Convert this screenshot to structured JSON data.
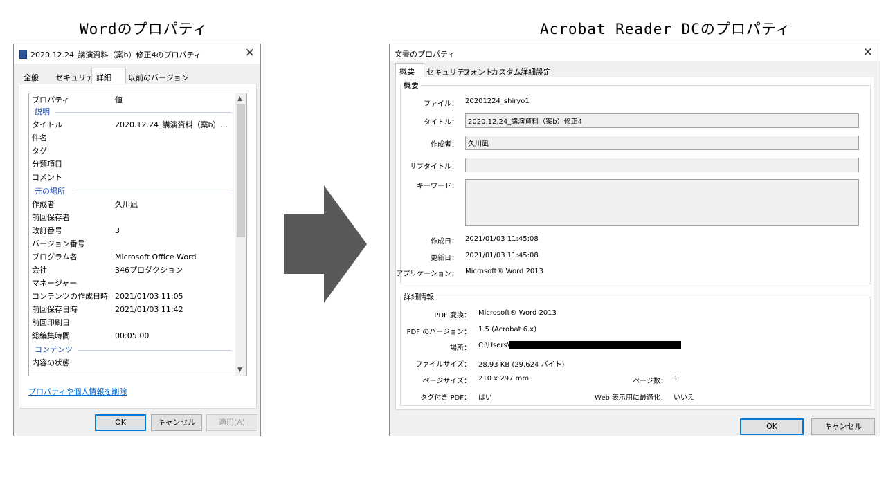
{
  "headings": {
    "left": "Wordのプロパティ",
    "right": "Acrobat Reader DCのプロパティ"
  },
  "colors": {
    "accent": "#0078d7",
    "arrow": "#595959",
    "group_header": "#1e4fb3",
    "link": "#0066cc"
  },
  "word": {
    "window_title": "2020.12.24_講演資料（案b）修正4のプロパティ",
    "icon": "word-doc-icon",
    "close": "✕",
    "tabs": [
      "全般",
      "セキュリティ",
      "詳細",
      "以前のバージョン"
    ],
    "active_tab": "詳細",
    "columns": {
      "property": "プロパティ",
      "value": "値"
    },
    "groups": {
      "description": "説明",
      "origin": "元の場所",
      "content": "コンテンツ"
    },
    "rows": [
      {
        "name": "タイトル",
        "value": "2020.12.24_講演資料（案b）..."
      },
      {
        "name": "件名",
        "value": ""
      },
      {
        "name": "タグ",
        "value": ""
      },
      {
        "name": "分類項目",
        "value": ""
      },
      {
        "name": "コメント",
        "value": ""
      },
      {
        "name": "作成者",
        "value": "久川凪"
      },
      {
        "name": "前回保存者",
        "value": ""
      },
      {
        "name": "改訂番号",
        "value": "3"
      },
      {
        "name": "バージョン番号",
        "value": ""
      },
      {
        "name": "プログラム名",
        "value": "Microsoft Office Word"
      },
      {
        "name": "会社",
        "value": "346プロダクション"
      },
      {
        "name": "マネージャー",
        "value": ""
      },
      {
        "name": "コンテンツの作成日時",
        "value": "2021/01/03 11:05"
      },
      {
        "name": "前回保存日時",
        "value": "2021/01/03 11:42"
      },
      {
        "name": "前回印刷日",
        "value": ""
      },
      {
        "name": "総編集時間",
        "value": "00:05:00"
      },
      {
        "name": "内容の状態",
        "value": ""
      }
    ],
    "remove_link": "プロパティや個人情報を削除",
    "buttons": {
      "ok": "OK",
      "cancel": "キャンセル",
      "apply": "適用(A)"
    }
  },
  "acrobat": {
    "window_title": "文書のプロパティ",
    "close": "✕",
    "tabs": [
      "概要",
      "セキュリティ",
      "フォント",
      "カスタム",
      "詳細設定"
    ],
    "active_tab": "概要",
    "summary_group": "概要",
    "file_label": "ファイル：",
    "file_value": "20201224_shiryo1",
    "title_label": "タイトル：",
    "title_value": "2020.12.24_講演資料（案b）修正4",
    "author_label": "作成者：",
    "author_value": "久川凪",
    "subject_label": "サブタイトル：",
    "subject_value": "",
    "keywords_label": "キーワード：",
    "keywords_value": "",
    "created_label": "作成日：",
    "created_value": "2021/01/03 11:45:08",
    "modified_label": "更新日：",
    "modified_value": "2021/01/03 11:45:08",
    "application_label": "アプリケーション：",
    "application_value": "Microsoft® Word 2013",
    "details_group": "詳細情報",
    "producer_label": "PDF 変換：",
    "producer_value": "Microsoft® Word 2013",
    "version_label": "PDF のバージョン：",
    "version_value": "1.5 (Acrobat 6.x)",
    "location_label": "場所：",
    "location_value": "C:\\Users\\",
    "filesize_label": "ファイルサイズ：",
    "filesize_value": "28.93 KB (29,624 バイト)",
    "pagesize_label": "ページサイズ：",
    "pagesize_value": "210 x 297 mm",
    "pagecount_label": "ページ数：",
    "pagecount_value": "1",
    "tagged_label": "タグ付き PDF：",
    "tagged_value": "はい",
    "fastweb_label": "Web 表示用に最適化：",
    "fastweb_value": "いいえ",
    "buttons": {
      "ok": "OK",
      "cancel": "キャンセル"
    }
  }
}
